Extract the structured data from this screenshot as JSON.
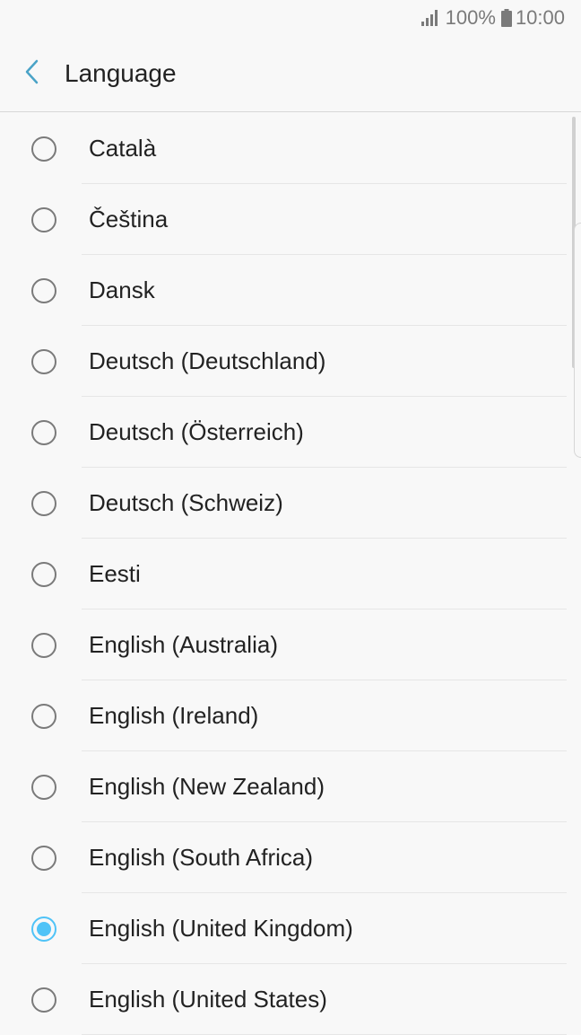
{
  "status_bar": {
    "battery_percent": "100%",
    "time": "10:00"
  },
  "header": {
    "title": "Language"
  },
  "languages": [
    {
      "label": "Català",
      "selected": false
    },
    {
      "label": "Čeština",
      "selected": false
    },
    {
      "label": "Dansk",
      "selected": false
    },
    {
      "label": "Deutsch (Deutschland)",
      "selected": false
    },
    {
      "label": "Deutsch (Österreich)",
      "selected": false
    },
    {
      "label": "Deutsch (Schweiz)",
      "selected": false
    },
    {
      "label": "Eesti",
      "selected": false
    },
    {
      "label": "English (Australia)",
      "selected": false
    },
    {
      "label": "English (Ireland)",
      "selected": false
    },
    {
      "label": "English (New Zealand)",
      "selected": false
    },
    {
      "label": "English (South Africa)",
      "selected": false
    },
    {
      "label": "English (United Kingdom)",
      "selected": true
    },
    {
      "label": "English (United States)",
      "selected": false
    }
  ],
  "colors": {
    "accent": "#4fc3f7",
    "background": "#f8f8f8"
  }
}
